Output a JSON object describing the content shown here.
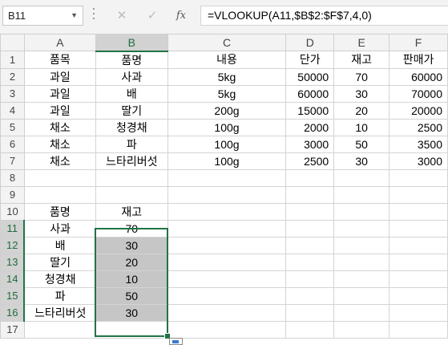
{
  "name_box": "B11",
  "formula_bar": {
    "cancel_icon": "✕",
    "enter_icon": "✓",
    "function_icon": "fx",
    "formula": "=VLOOKUP(A11,$B$2:$F$7,4,0)"
  },
  "columns": [
    "A",
    "B",
    "C",
    "D",
    "E",
    "F"
  ],
  "rows": [
    "1",
    "2",
    "3",
    "4",
    "5",
    "6",
    "7",
    "8",
    "9",
    "10",
    "11",
    "12",
    "13",
    "14",
    "15",
    "16",
    "17"
  ],
  "table": {
    "headers": [
      "품목",
      "품명",
      "내용",
      "단가",
      "재고",
      "판매가"
    ],
    "rows": [
      [
        "과일",
        "사과",
        "5kg",
        "50000",
        "70",
        "60000"
      ],
      [
        "과일",
        "배",
        "5kg",
        "60000",
        "30",
        "70000"
      ],
      [
        "과일",
        "딸기",
        "200g",
        "15000",
        "20",
        "20000"
      ],
      [
        "채소",
        "청경채",
        "100g",
        "2000",
        "10",
        "2500"
      ],
      [
        "채소",
        "파",
        "100g",
        "3000",
        "50",
        "3500"
      ],
      [
        "채소",
        "느타리버섯",
        "100g",
        "2500",
        "30",
        "3000"
      ]
    ]
  },
  "lookup": {
    "headers": [
      "품명",
      "재고"
    ],
    "rows": [
      [
        "사과",
        "70"
      ],
      [
        "배",
        "30"
      ],
      [
        "딸기",
        "20"
      ],
      [
        "청경채",
        "10"
      ],
      [
        "파",
        "50"
      ],
      [
        "느타리버섯",
        "30"
      ]
    ]
  },
  "colors": {
    "selection": "#217346",
    "shade": "#c6c6c6"
  }
}
